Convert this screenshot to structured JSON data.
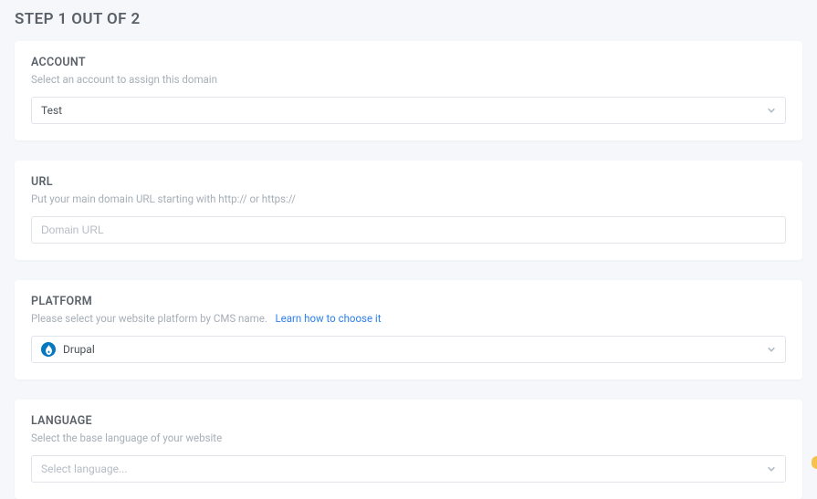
{
  "page": {
    "heading": "STEP 1 OUT OF 2"
  },
  "account": {
    "heading": "ACCOUNT",
    "sub": "Select an account to assign this domain",
    "selected": "Test"
  },
  "url": {
    "heading": "URL",
    "sub": "Put your main domain URL starting with http:// or https://",
    "placeholder": "Domain URL",
    "value": ""
  },
  "platform": {
    "heading": "PLATFORM",
    "sub": "Please select your website platform by CMS name.",
    "link_text": "Learn how to choose it",
    "selected": "Drupal",
    "icon": "drupal-icon"
  },
  "language": {
    "heading": "LANGUAGE",
    "sub": "Select the base language of your website",
    "placeholder": "Select language..."
  }
}
